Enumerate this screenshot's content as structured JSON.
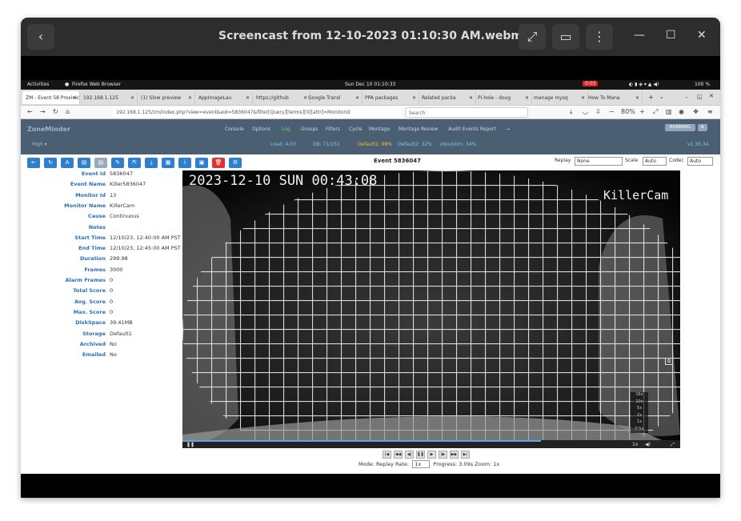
{
  "window": {
    "title": "Screencast from 12-10-2023 01:10:30 AM.webm"
  },
  "gnome": {
    "activities": "Activities",
    "app": "Firefox Web Browser",
    "clock": "Sun Dec 10  01:10:33",
    "rec": "0:03",
    "battery": "100 %"
  },
  "tabs": [
    {
      "label": "ZM - Event 58 Proxinic"
    },
    {
      "label": "192.168.1.125"
    },
    {
      "label": "(1) Slow preview"
    },
    {
      "label": "AppImageLau"
    },
    {
      "label": "https://github"
    },
    {
      "label": "Google Transl"
    },
    {
      "label": "PPA packages"
    },
    {
      "label": "Related packa"
    },
    {
      "label": "Pi-hole - doug"
    },
    {
      "label": "manage mysq"
    },
    {
      "label": "How To Mana"
    }
  ],
  "nav": {
    "url": "192.168.1.125/zm/index.php?view=event&eid=5836047&filter[Query][terms][0][attr]=Monitorid",
    "search_placeholder": "Search",
    "zoom": "80%"
  },
  "zm": {
    "logo": "ZoneMinder",
    "menu": [
      "Console",
      "Options",
      "Log",
      "Groups",
      "Filters",
      "Cycle",
      "Montage",
      "Montage Review",
      "Audit Events Report",
      "→"
    ],
    "bandwidth": "High ▾",
    "load": "Load: 4.03",
    "db": "DB: 71/151",
    "storage": "Default1: 98%",
    "storage2": "Default2: 32%",
    "shm": "/dev/shm: 34%",
    "version": "v1.36.34",
    "running": "RUNNING"
  },
  "event": {
    "title": "Event 5836047",
    "replay_label": "Replay",
    "replay_value": "None",
    "scale_label": "Scale",
    "scale_value": "Auto",
    "codec_label": "Codec",
    "codec_value": "Auto",
    "details": [
      {
        "label": "Event Id",
        "value": "5836047"
      },
      {
        "label": "Event Name",
        "value": "Killer5836047"
      },
      {
        "label": "Monitor Id",
        "value": "13"
      },
      {
        "label": "Monitor Name",
        "value": "KillerCam"
      },
      {
        "label": "Cause",
        "value": "Continuous"
      },
      {
        "label": "Notes",
        "value": ""
      },
      {
        "label": "Start Time",
        "value": "12/10/23, 12:40:00 AM PST"
      },
      {
        "label": "End Time",
        "value": "12/10/23, 12:45:00 AM PST"
      },
      {
        "label": "Duration",
        "value": "299.98"
      },
      {
        "label": "Frames",
        "value": "3000"
      },
      {
        "label": "Alarm Frames",
        "value": "0"
      },
      {
        "label": "Total Score",
        "value": "0"
      },
      {
        "label": "Avg. Score",
        "value": "0"
      },
      {
        "label": "Max. Score",
        "value": "0"
      },
      {
        "label": "DiskSpace",
        "value": "39.41MB"
      },
      {
        "label": "Storage",
        "value": "Default1"
      },
      {
        "label": "Archived",
        "value": "No"
      },
      {
        "label": "Emailed",
        "value": "No"
      }
    ],
    "overlay_time": "2023-12-10  SUN 00:43:08",
    "overlay_cam": "KillerCam",
    "speeds": [
      "16x",
      "10x",
      "5x",
      "2x",
      "1x",
      "0.5x"
    ],
    "mode_line": "Mode: Replay  Rate:",
    "rate": "1x",
    "progress": "Progress: 3.09s Zoom: 1x",
    "playback_fraction": 0.72
  }
}
